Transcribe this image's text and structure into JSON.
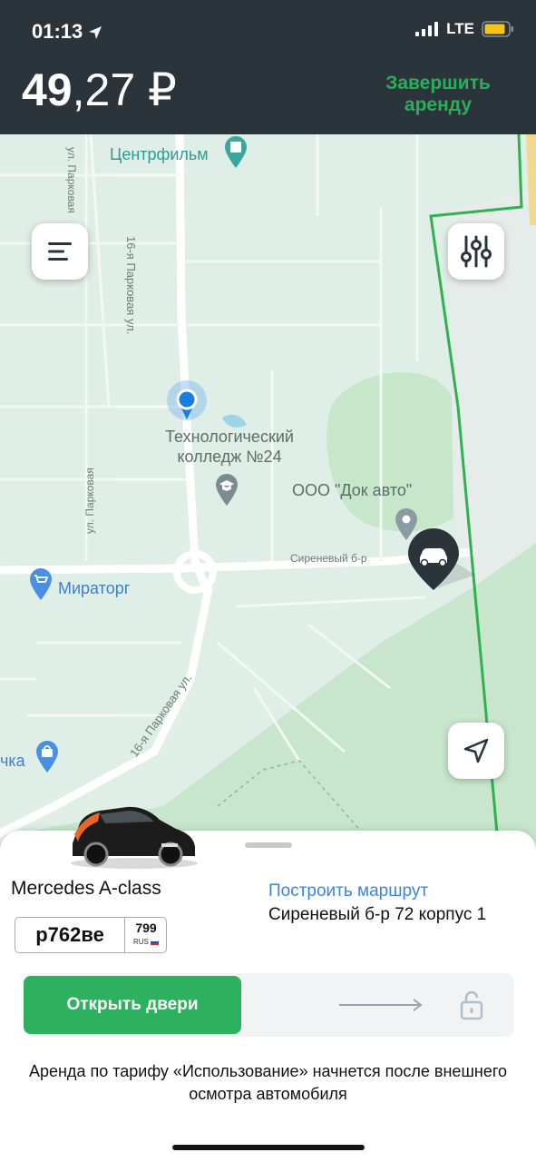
{
  "status_bar": {
    "time": "01:13",
    "network": "LTE"
  },
  "header": {
    "price_main": "49",
    "price_fraction": ",27 ₽",
    "finish_label": "Завершить аренду"
  },
  "map": {
    "labels": {
      "centrfilm": "Центрфильм",
      "tech_college": "Технологический колледж №24",
      "dok_avto": "ООО \"Док авто\"",
      "miratorg": "Мираторг",
      "partial_left": "чка",
      "park_street_vertical": "16-я Парковая ул.",
      "park_street_diagonal": "16-я Парковая ул.",
      "ul_parkovaya_top": "ул. Парковая",
      "ul_parkovaya_left": "ул. Парковая",
      "sirenevy": "Сиреневый б-р"
    }
  },
  "car": {
    "name": "Mercedes A-class",
    "plate_number": "р762ве",
    "plate_region": "799",
    "plate_country": "RUS",
    "route_link": "Построить маршрут",
    "address": "Сиреневый б-р 72 корпус 1"
  },
  "actions": {
    "open_doors": "Открыть двери"
  },
  "info_text": "Аренда по тарифу «Использование» начнется после внешнего осмотра автомобиля",
  "colors": {
    "header_bg": "#2b343a",
    "accent_green": "#2eb15f",
    "link_blue": "#3a86d9",
    "map_bg": "#dfeee6",
    "park_green": "#bfe2c3"
  },
  "icons": [
    "location-arrow-icon",
    "signal-icon",
    "battery-icon",
    "centrfilm-poi-icon",
    "college-poi-icon",
    "dok-avto-poi-icon",
    "miratorg-poi-icon",
    "shop-poi-icon",
    "user-location-icon",
    "car-marker-icon",
    "menu-icon",
    "filter-icon",
    "my-location-icon",
    "arrow-right-icon",
    "lock-icon"
  ]
}
